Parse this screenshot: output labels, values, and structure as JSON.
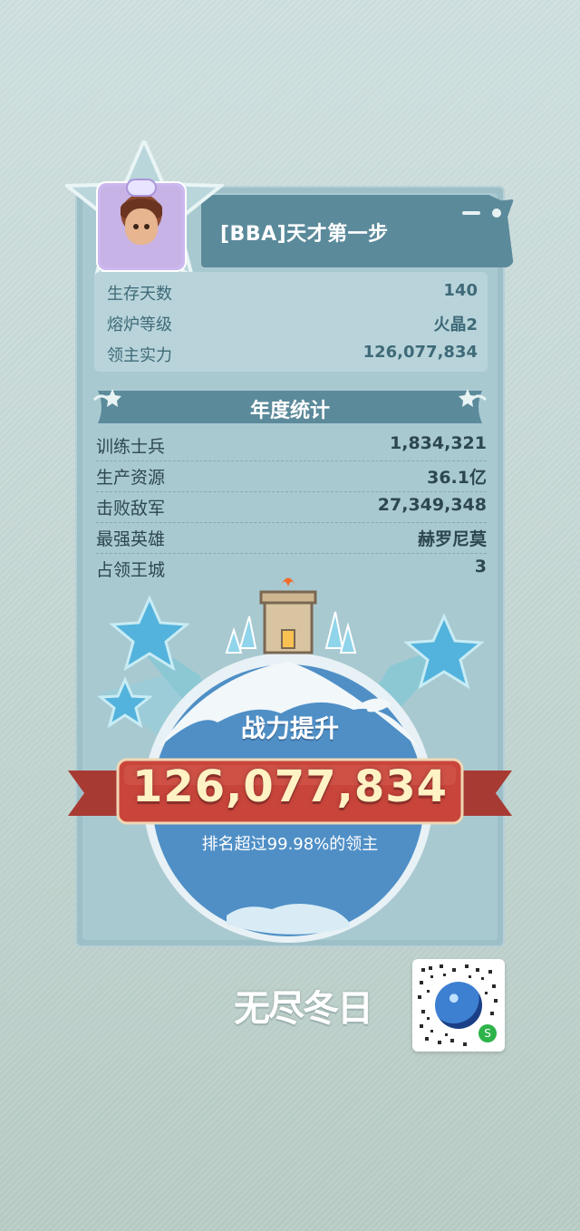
{
  "player": {
    "name": "[BBA]天才第一步",
    "stats": [
      {
        "label": "生存天数",
        "value": "140"
      },
      {
        "label": "熔炉等级",
        "value": "火晶2"
      },
      {
        "label": "领主实力",
        "value": "126,077,834"
      }
    ]
  },
  "annual": {
    "title": "年度统计",
    "rows": [
      {
        "label": "训练士兵",
        "value": "1,834,321"
      },
      {
        "label": "生产资源",
        "value": "36.1亿"
      },
      {
        "label": "击败敌军",
        "value": "27,349,348"
      },
      {
        "label": "最强英雄",
        "value": "赫罗尼莫"
      },
      {
        "label": "占领王城",
        "value": "3"
      }
    ]
  },
  "power": {
    "title": "战力提升",
    "value": "126,077,834",
    "rank_text": "排名超过99.98%的领主"
  },
  "brand": {
    "logo_text": "无尽冬日"
  },
  "colors": {
    "card": "#9dbfc8",
    "banner": "#5b8a9b",
    "ribbon": "#c9453b",
    "globe": "#4f8fc6"
  }
}
